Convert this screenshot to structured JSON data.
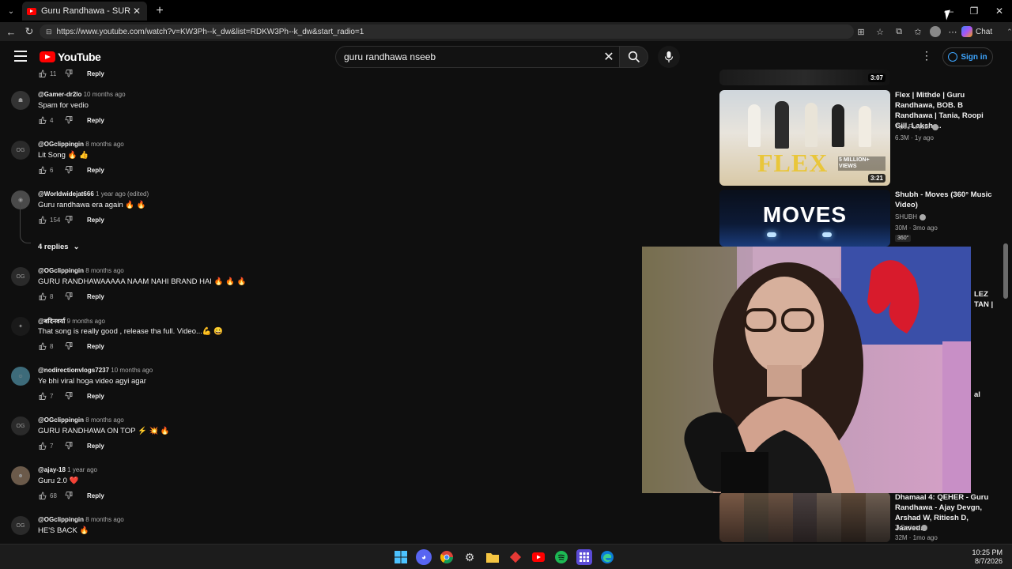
{
  "browser": {
    "tab_title": "Guru Randhawa - SURREY CONNE...",
    "url": "https://www.youtube.com/watch?v=KW3Ph--k_dw&list=RDKW3Ph--k_dw&start_radio=1",
    "chat_label": "Chat"
  },
  "youtube": {
    "logo_text": "YouTube",
    "search_value": "guru randhawa nseeb",
    "signin_label": "Sign in"
  },
  "comments": {
    "top_partial": {
      "likes": "11",
      "reply": "Reply"
    },
    "items": [
      {
        "handle": "@Gamer-dr2lo",
        "time": "10 months ago",
        "text": "Spam for vedio",
        "likes": "4",
        "reply": "Reply"
      },
      {
        "handle": "@OGclippingin",
        "time": "8 months ago",
        "text": "Lit Song 🔥 👍",
        "likes": "6",
        "reply": "Reply"
      },
      {
        "handle": "@Worldwidejat666",
        "time": "1 year ago (edited)",
        "text": "Guru randhawa era again 🔥 🔥",
        "likes": "154",
        "reply": "Reply"
      },
      {
        "handle": "@OGclippingin",
        "time": "8 months ago",
        "text": "GURU RANDHAWAAAAA NAAM NAHI BRAND HAI 🔥 🔥 🔥",
        "likes": "8",
        "reply": "Reply"
      },
      {
        "handle": "@बदिनवर्या",
        "time": "9 months ago",
        "text": "That song is really good , release tha full. Video...💪 😀",
        "likes": "8",
        "reply": "Reply"
      },
      {
        "handle": "@nodirectionvlogs7237",
        "time": "10 months ago",
        "text": "Ye bhi viral hoga video agyi agar",
        "likes": "7",
        "reply": "Reply"
      },
      {
        "handle": "@OGclippingin",
        "time": "8 months ago",
        "text": "GURU RANDHAWA ON TOP ⚡ 💥 🔥",
        "likes": "7",
        "reply": "Reply"
      },
      {
        "handle": "@ajay-18",
        "time": "1 year ago",
        "text": "Guru 2.0 ❤️",
        "likes": "68",
        "reply": "Reply"
      },
      {
        "handle": "@OGclippingin",
        "time": "8 months ago",
        "text": "HE'S BACK 🔥",
        "likes": "",
        "reply": ""
      }
    ],
    "replies_toggle": "4 replies"
  },
  "sidebar": {
    "top_partial": {
      "duration": "3:07"
    },
    "videos": [
      {
        "title": "Flex | Mithde | Guru Randhawa, BOB. B Randhawa | Tania, Roopi Gill, Laksh ...",
        "channel": "Tips Punjabi",
        "meta": "6.3M · 1y ago",
        "duration": "3:21",
        "thumb_text": "FLEX",
        "thumb_badge": "5 MILLION+ VIEWS"
      },
      {
        "title": "Shubh - Moves (360° Music Video)",
        "channel": "SHUBH",
        "meta": "30M · 3mo ago",
        "badge": "360°",
        "thumb_text": "MOVES"
      },
      {
        "title": "Dhamaal 4: QEHER - Guru Randhawa - Ajay Devgn, Arshad W, Ritiesh D, Jaaved...",
        "channel": "T-Series",
        "meta": "32M · 1mo ago"
      }
    ],
    "hidden_partial": {
      "line1": "LEZ",
      "line2": "TAN |",
      "line3": "al"
    }
  },
  "taskbar": {
    "time": "10:25 PM",
    "date": "8/7/2026"
  }
}
